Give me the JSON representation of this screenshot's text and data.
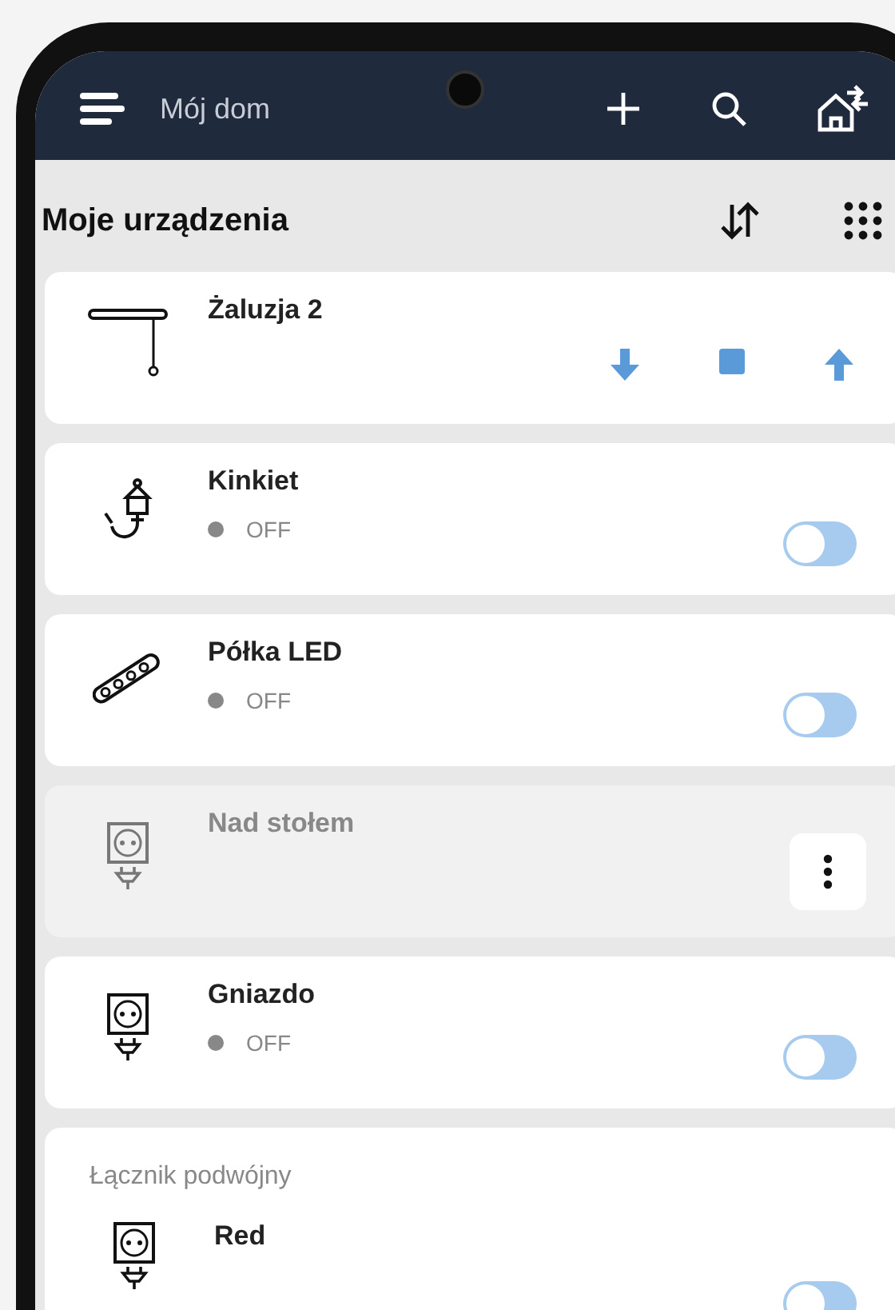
{
  "app_bar": {
    "title": "Mój dom"
  },
  "section": {
    "title": "Moje urządzenia"
  },
  "devices": [
    {
      "kind": "blind",
      "name": "Żaluzja 2",
      "disabled": false
    },
    {
      "kind": "lamp",
      "name": "Kinkiet",
      "status": "OFF",
      "on": false,
      "disabled": false
    },
    {
      "kind": "led_strip",
      "name": "Półka LED",
      "status": "OFF",
      "on": false,
      "disabled": false
    },
    {
      "kind": "socket",
      "name": "Nad stołem",
      "disabled": true
    },
    {
      "kind": "socket",
      "name": "Gniazdo",
      "status": "OFF",
      "on": false,
      "disabled": false
    }
  ],
  "group": {
    "label": "Łącznik podwójny",
    "children": [
      {
        "kind": "socket",
        "name": "Red",
        "on": false
      }
    ]
  }
}
